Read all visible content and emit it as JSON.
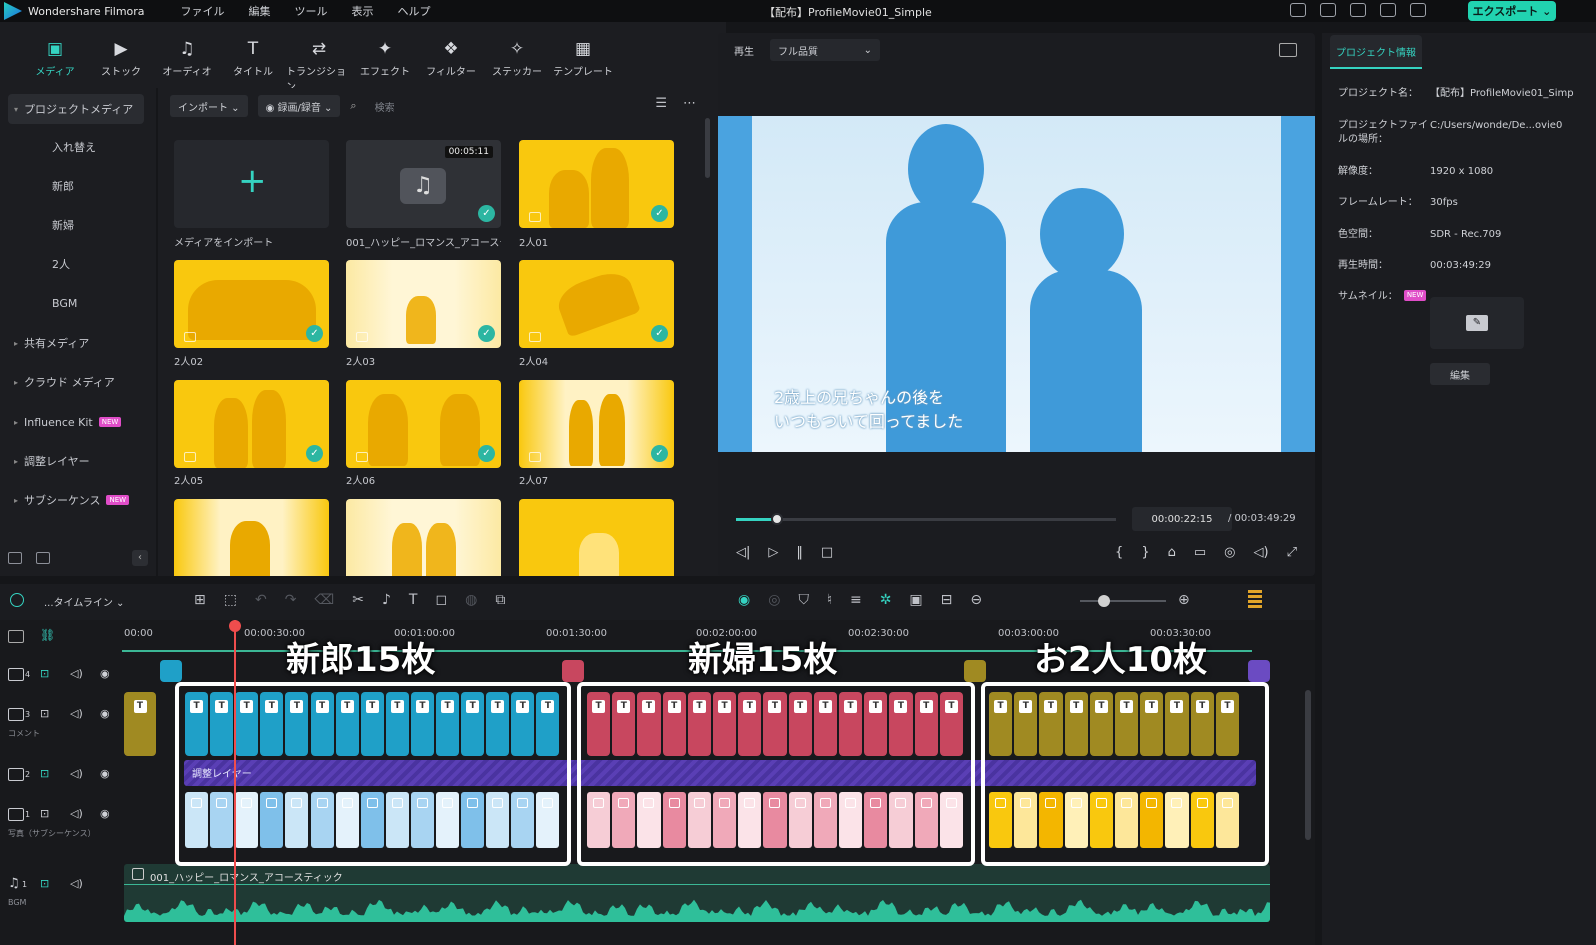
{
  "app": {
    "name": "Wondershare Filmora",
    "doc_title": "【配布】ProfileMovie01_Simple",
    "export_label": "エクスポート ⌄"
  },
  "menu": [
    "ファイル",
    "編集",
    "ツール",
    "表示",
    "ヘルプ"
  ],
  "toolbar": [
    {
      "label": "メディア",
      "icon": "▣"
    },
    {
      "label": "ストック",
      "icon": "▶"
    },
    {
      "label": "オーディオ",
      "icon": "♫"
    },
    {
      "label": "タイトル",
      "icon": "T"
    },
    {
      "label": "トランジション",
      "icon": "⇄"
    },
    {
      "label": "エフェクト",
      "icon": "✦"
    },
    {
      "label": "フィルター",
      "icon": "❖"
    },
    {
      "label": "ステッカー",
      "icon": "✧"
    },
    {
      "label": "テンプレート",
      "icon": "▦"
    }
  ],
  "sidebar": {
    "items": [
      {
        "label": "プロジェクトメディア",
        "caret": "▾"
      },
      {
        "label": "入れ替え",
        "caret": ""
      },
      {
        "label": "新郎",
        "caret": ""
      },
      {
        "label": "新婦",
        "caret": ""
      },
      {
        "label": "2人",
        "caret": ""
      },
      {
        "label": "BGM",
        "caret": ""
      },
      {
        "label": "共有メディア",
        "caret": "▸"
      },
      {
        "label": "クラウド メディア",
        "caret": "▸"
      },
      {
        "label": "Influence Kit",
        "caret": "▸",
        "badge": "NEW"
      },
      {
        "label": "調整レイヤー",
        "caret": "▸"
      },
      {
        "label": "サブシーケンス",
        "caret": "▸",
        "badge": "NEW"
      }
    ]
  },
  "media": {
    "import_label": "インポート ⌄",
    "record_label": "◉ 録画/録音 ⌄",
    "search_placeholder": "検索",
    "items": [
      {
        "label": "メディアをインポート"
      },
      {
        "label": "001_ハッピー_ロマンス_アコーステ...",
        "duration": "00:05:11"
      },
      {
        "label": "2人01"
      },
      {
        "label": "2人02"
      },
      {
        "label": "2人03"
      },
      {
        "label": "2人04"
      },
      {
        "label": "2人05"
      },
      {
        "label": "2人06"
      },
      {
        "label": "2人07"
      },
      {
        "label": ""
      },
      {
        "label": ""
      },
      {
        "label": ""
      }
    ]
  },
  "preview": {
    "play_label": "再生",
    "quality": "フル品質",
    "subtitle_line1": "2歳上の兄ちゃんの後を",
    "subtitle_line2": "いつもついて回ってました",
    "current_time": "00:00:22:15",
    "total_time": "/ 00:03:49:29",
    "progress": 0.108
  },
  "info": {
    "tab": "プロジェクト情報",
    "rows": [
      {
        "k": "プロジェクト名：",
        "v": "【配布】ProfileMovie01_Simp"
      },
      {
        "k": "プロジェクトファイルの場所：",
        "v": "C:/Users/wonde/De...ovie0"
      },
      {
        "k": "解像度：",
        "v": "1920 x 1080"
      },
      {
        "k": "フレームレート：",
        "v": "30fps"
      },
      {
        "k": "色空間：",
        "v": "SDR - Rec.709"
      },
      {
        "k": "再生時間：",
        "v": "00:03:49:29"
      },
      {
        "k": "サムネイル：",
        "v": ""
      }
    ],
    "thumb_badge": "NEW",
    "edit_label": "編集"
  },
  "timeline": {
    "name": "...タイムライン ⌄",
    "ruler": [
      "00:00",
      "00:00:30:00",
      "00:01:00:00",
      "00:01:30:00",
      "00:02:00:00",
      "00:02:30:00",
      "00:03:00:00",
      "00:03:30:00"
    ],
    "overlays": [
      "新郎15枚",
      "新婦15枚",
      "お2人10枚"
    ],
    "tracks": [
      {
        "num": "4",
        "sub": ""
      },
      {
        "num": "3",
        "sub": "コメント"
      },
      {
        "num": "2",
        "sub": ""
      },
      {
        "num": "1",
        "sub": "写真（サブシーケンス）"
      },
      {
        "num": "1",
        "sub": "BGM"
      }
    ],
    "adjust_label": "調整レイヤー",
    "bgm_label": "001_ハッピー_ロマンス_アコースティック",
    "colors": {
      "groom": "#1fa0c8",
      "bride": "#c8475f",
      "couple": "#a08a22"
    }
  }
}
